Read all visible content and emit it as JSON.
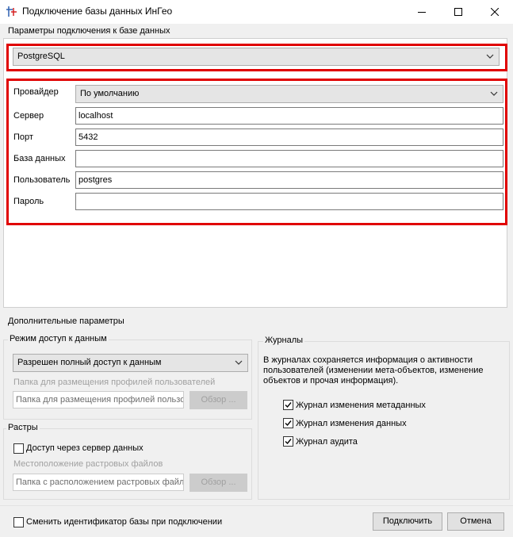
{
  "window": {
    "title": "Подключение базы данных ИнГео",
    "controls": [
      "minimize-icon",
      "maximize-icon",
      "close-icon"
    ]
  },
  "connection": {
    "group_title": "Параметры подключения к базе данных",
    "db_type": "PostgreSQL",
    "provider_label": "Провайдер",
    "provider_value": "По умолчанию",
    "server_label": "Сервер",
    "server_value": "localhost",
    "port_label": "Порт",
    "port_value": "5432",
    "database_label": "База данных",
    "database_value": "",
    "user_label": "Пользователь",
    "user_value": "postgres",
    "password_label": "Пароль",
    "password_value": ""
  },
  "additional": {
    "group_title": "Дополнительные параметры",
    "access": {
      "title": "Режим доступ к данным",
      "mode_value": "Разрешен полный доступ к данным",
      "profiles_label": "Папка для размещения профилей пользователей",
      "profiles_placeholder": "Папка для размещения профилей пользователей",
      "browse_label": "Обзор ..."
    },
    "rasters": {
      "title": "Растры",
      "server_access_label": "Доступ через сервер данных",
      "server_access_checked": false,
      "location_label": "Местоположение растровых файлов",
      "location_placeholder": "Папка с расположением растровых файлов",
      "browse_label": "Обзор ..."
    },
    "logs": {
      "title": "Журналы",
      "description": "В журналах сохраняется информация о активности пользователей (изменении мета-объектов, изменение объектов и прочая информация).",
      "items": [
        {
          "label": "Журнал изменения метаданных",
          "checked": true
        },
        {
          "label": "Журнал изменения данных",
          "checked": true
        },
        {
          "label": "Журнал аудита",
          "checked": true
        }
      ]
    }
  },
  "footer": {
    "change_id_label": "Сменить идентификатор базы при подключении",
    "change_id_checked": false,
    "connect_label": "Подключить",
    "cancel_label": "Отмена"
  },
  "colors": {
    "highlight": "#e00000",
    "background": "#f0f0f0"
  }
}
